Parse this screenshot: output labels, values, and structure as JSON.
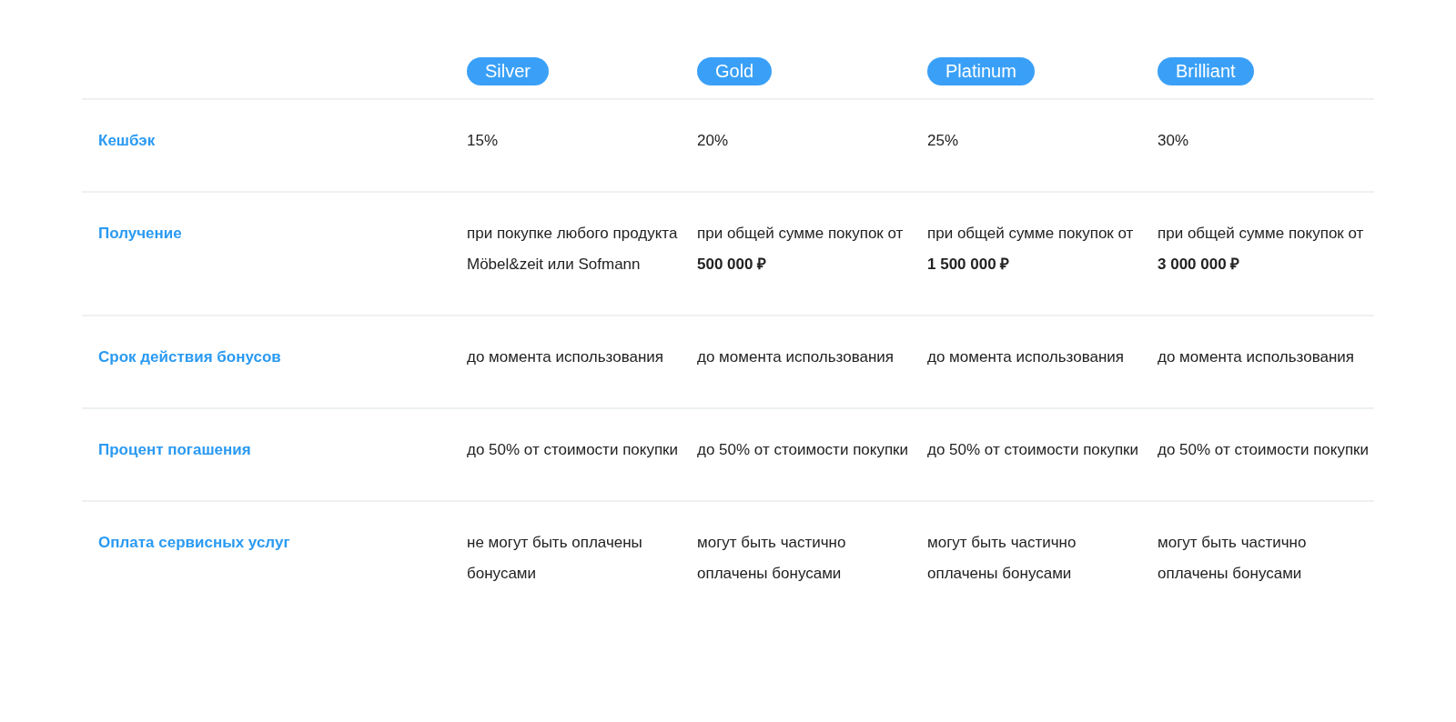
{
  "tiers": [
    {
      "name": "Silver"
    },
    {
      "name": "Gold"
    },
    {
      "name": "Platinum"
    },
    {
      "name": "Brilliant"
    }
  ],
  "rows": [
    {
      "label": "Кешбэк",
      "cells": [
        "15%",
        "20%",
        "25%",
        "30%"
      ]
    },
    {
      "label": "Получение",
      "cells": [
        "при покупке любого продукта Möbel&zeit или Sofmann",
        "при общей сумме покупок от **500 000 ₽**",
        "при общей сумме покупок от **1 500 000 ₽**",
        "при общей сумме покупок от **3 000 000 ₽**"
      ]
    },
    {
      "label": "Срок действия бонусов",
      "cells": [
        "до момента использования",
        "до момента использования",
        "до момента использования",
        "до момента использования"
      ]
    },
    {
      "label": "Процент погашения",
      "cells": [
        "до 50% от стоимости покупки",
        "до 50% от стоимости покупки",
        "до 50% от стоимости покупки",
        "до 50% от стоимости покупки"
      ]
    },
    {
      "label": "Оплата сервисных услуг",
      "cells": [
        "не могут быть оплачены бонусами",
        "могут быть частично оплачены бонусами",
        "могут быть частично оплачены бонусами",
        "могут быть частично оплачены бонусами"
      ]
    }
  ]
}
